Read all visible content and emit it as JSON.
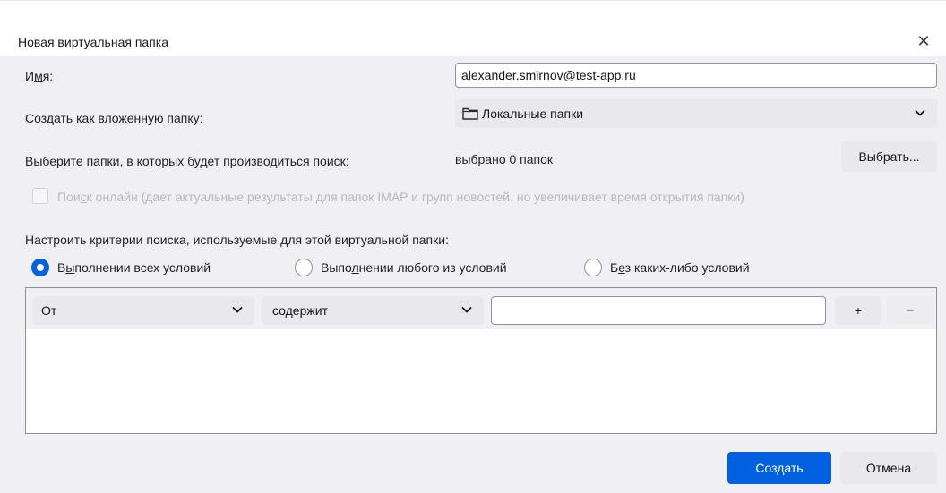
{
  "window": {
    "title": "Новая виртуальная папка",
    "close_glyph": "✕"
  },
  "form": {
    "name_label_prefix": "И",
    "name_label_u": "м",
    "name_label_suffix": "я:",
    "name_value": "alexander.smirnov@test-app.ru",
    "create_as_label": "Создать как вложенную папку:",
    "parent_folder_value": "Локальные папки",
    "select_folders_label": "Выберите папки, в которых будет производиться поиск:",
    "selected_count": "выбрано 0 папок",
    "choose_button": "Выбрать...",
    "online_search_prefix": "Пои",
    "online_search_u": "с",
    "online_search_suffix": "к онлайн (дает актуальные результаты для папок IMAP и групп новостей, но увеличивает время открытия папки)",
    "criteria_heading": "Настроить критерии поиска, используемые для этой виртуальной папки:"
  },
  "match": {
    "all": {
      "prefix": "В",
      "u": "ы",
      "suffix": "полнении всех условий",
      "selected": true
    },
    "any": {
      "prefix": "Выпо",
      "u": "л",
      "suffix": "нении любого из условий",
      "selected": false
    },
    "none": {
      "prefix": "Б",
      "u": "е",
      "suffix": "з каких-либо условий",
      "selected": false
    }
  },
  "criteria": {
    "field": "От",
    "operator": "содержит",
    "value": "",
    "add_label": "+",
    "remove_label": "−"
  },
  "footer": {
    "create_button": "Создать",
    "cancel_button": "Отмена"
  },
  "colors": {
    "accent": "#0061e0",
    "dialog_bg": "#f0f0f4",
    "button_bg": "#e9e9ed"
  },
  "icons": {
    "close": "close-icon",
    "folder": "folder-icon",
    "chevron": "chevron-down-icon"
  }
}
